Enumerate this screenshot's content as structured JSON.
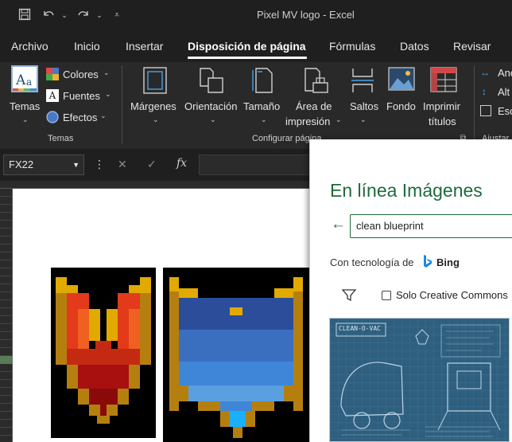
{
  "window": {
    "title": "Pixel MV logo  -  Excel"
  },
  "quick_access": {
    "save": "save-icon",
    "undo": "undo-icon",
    "redo": "redo-icon",
    "customize": "customize-icon"
  },
  "tabs": [
    {
      "label": "Archivo"
    },
    {
      "label": "Inicio"
    },
    {
      "label": "Insertar"
    },
    {
      "label": "Disposición de página",
      "active": true
    },
    {
      "label": "Fórmulas"
    },
    {
      "label": "Datos"
    },
    {
      "label": "Revisar"
    }
  ],
  "ribbon": {
    "temas_group": {
      "temas": "Temas",
      "colores": "Colores",
      "fuentes": "Fuentes",
      "efectos": "Efectos",
      "group_label": "Temas"
    },
    "configurar_group": {
      "margenes": "Márgenes",
      "orientacion": "Orientación",
      "tamano": "Tamaño",
      "area_line1": "Área de",
      "area_line2": "impresión",
      "saltos": "Saltos",
      "fondo": "Fondo",
      "imprimir_line1": "Imprimir",
      "imprimir_line2": "títulos",
      "group_label": "Configurar página"
    },
    "ajustar_group": {
      "ancho": "Anc",
      "alto": "Alt",
      "escala": "Esc",
      "group_label": "Ajustar"
    }
  },
  "formula_bar": {
    "name_box": "FX22",
    "cancel_icon": "✕",
    "enter_icon": "✓",
    "fx_label": "fx"
  },
  "panel": {
    "title": "En línea Imágenes",
    "search_value": "clean blueprint",
    "powered_by": "Con tecnología de",
    "bing": "Bing",
    "cc_filter_label": "Solo Creative Commons",
    "thumbnail": {
      "title": "CLEAN-O-VAC"
    }
  },
  "colors": {
    "accent_green": "#1e6b3c",
    "ribbon_bg": "#292929",
    "blueprint_bg": "#2f5f7e"
  }
}
